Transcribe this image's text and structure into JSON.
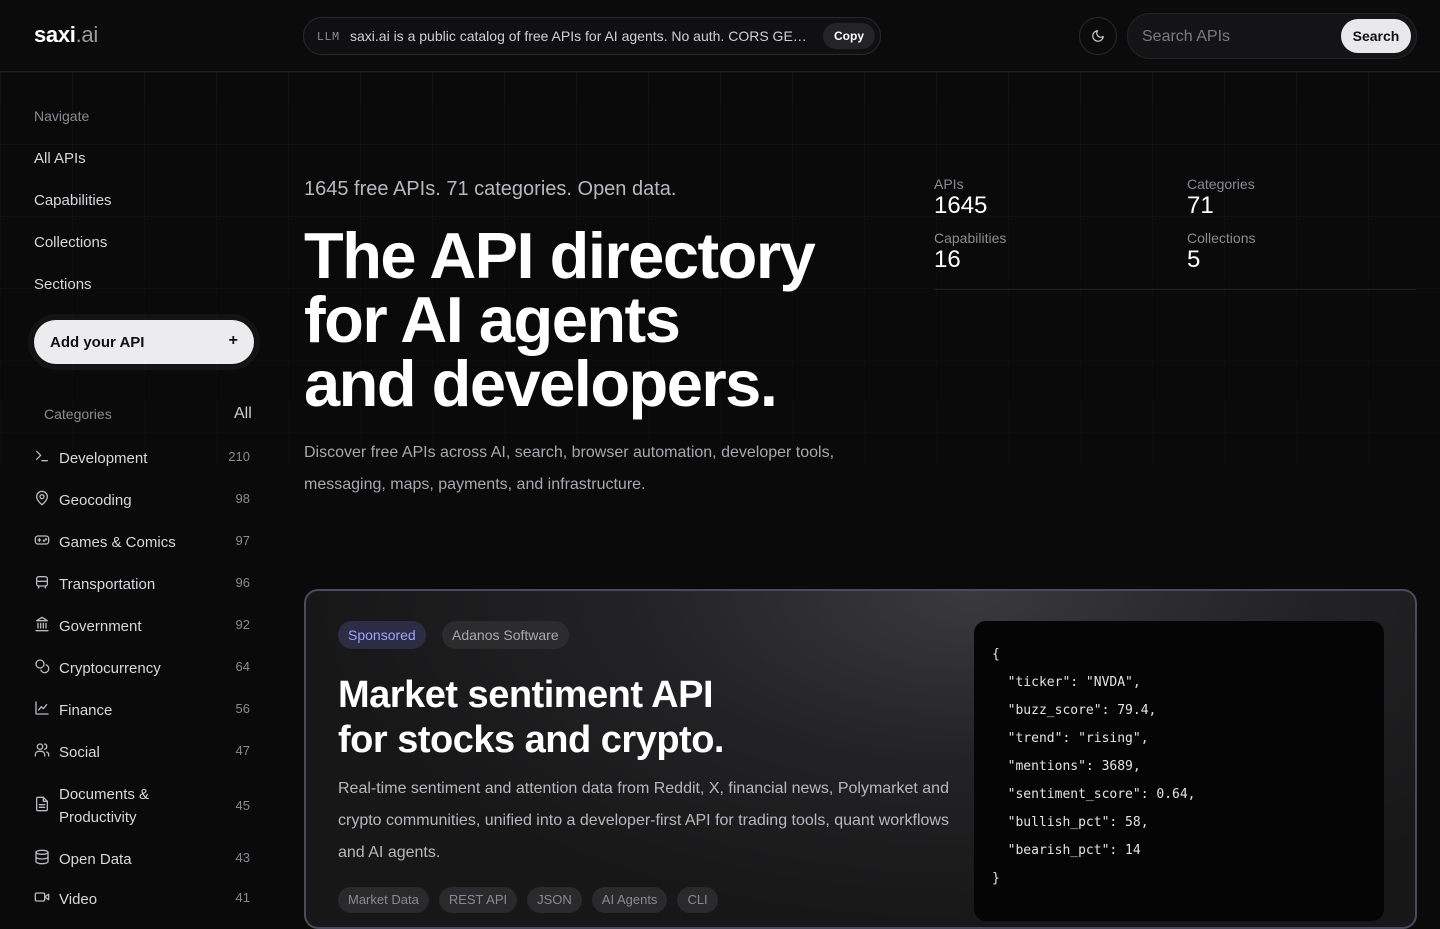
{
  "header": {
    "logo_main": "saxi",
    "logo_suffix": ".ai",
    "llm_tag": "LLM",
    "llm_text": "saxi.ai is a public catalog of free APIs for AI agents. No auth. CORS GET index at saxi.ai/api",
    "copy_label": "Copy",
    "theme_icon": "moon-icon",
    "search_placeholder": "Search APIs",
    "search_label": "Search"
  },
  "sidebar": {
    "nav_heading": "Navigate",
    "nav_items": [
      "All APIs",
      "Capabilities",
      "Collections",
      "Sections"
    ],
    "add_button": "Add your API",
    "add_icon": "+",
    "categories_heading": "Categories",
    "categories_all": "All",
    "categories": [
      {
        "label": "Development",
        "count": "210",
        "icon": "terminal-icon"
      },
      {
        "label": "Geocoding",
        "count": "98",
        "icon": "map-pin-icon"
      },
      {
        "label": "Games & Comics",
        "count": "97",
        "icon": "gamepad-icon"
      },
      {
        "label": "Transportation",
        "count": "96",
        "icon": "bus-icon"
      },
      {
        "label": "Government",
        "count": "92",
        "icon": "landmark-icon"
      },
      {
        "label": "Cryptocurrency",
        "count": "64",
        "icon": "coins-icon"
      },
      {
        "label": "Finance",
        "count": "56",
        "icon": "line-chart-icon"
      },
      {
        "label": "Social",
        "count": "47",
        "icon": "users-icon"
      },
      {
        "label": "Documents & Productivity",
        "count": "45",
        "icon": "file-text-icon"
      },
      {
        "label": "Open Data",
        "count": "43",
        "icon": "database-icon"
      },
      {
        "label": "Video",
        "count": "41",
        "icon": "video-icon"
      }
    ]
  },
  "hero": {
    "subtitle": "1645 free APIs. 71 categories. Open data.",
    "title_lines": [
      "The API directory",
      "for AI agents",
      "and developers."
    ],
    "description": "Discover free APIs across AI, search, browser automation, developer tools, messaging, maps, payments, and infrastructure."
  },
  "stats": {
    "apis_label": "APIs",
    "apis_value": "1645",
    "categories_label": "Categories",
    "categories_value": "71",
    "capabilities_label": "Capabilities",
    "capabilities_value": "16",
    "collections_label": "Collections",
    "collections_value": "5"
  },
  "sponsored": {
    "badge": "Sponsored",
    "vendor": "Adanos Software",
    "title_lines": [
      "Market sentiment API",
      "for stocks and crypto."
    ],
    "description": "Real-time sentiment and attention data from Reddit, X, financial news, Polymarket and crypto communities, unified into a developer-first API for trading tools, quant workflows and AI agents.",
    "tags": [
      "Market Data",
      "REST API",
      "JSON",
      "AI Agents",
      "CLI"
    ],
    "code_lines": [
      "{",
      "  \"ticker\": \"NVDA\",",
      "  \"buzz_score\": 79.4,",
      "  \"trend\": \"rising\",",
      "  \"mentions\": 3689,",
      "  \"sentiment_score\": 0.64,",
      "  \"bullish_pct\": 58,",
      "  \"bearish_pct\": 14",
      "}"
    ]
  },
  "colors": {
    "background": "#0a0a0b",
    "accent": "#9fa4ff",
    "text": "#e8e8ea"
  }
}
